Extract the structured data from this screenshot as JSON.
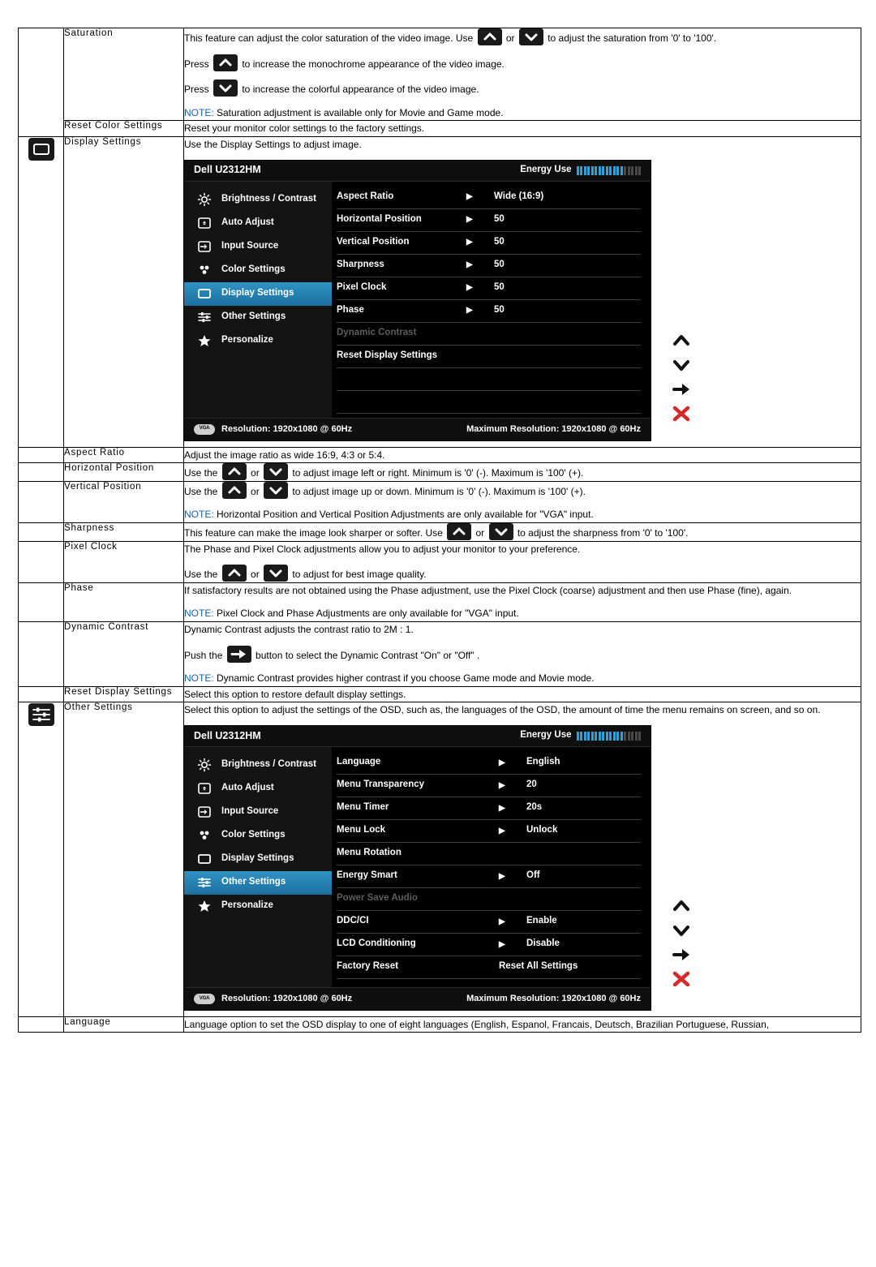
{
  "rows": [
    {
      "id": "saturation",
      "name": "Saturation",
      "lines": [
        {
          "type": "text-keys",
          "pre": "This feature can adjust the color saturation of the video image. Use ",
          "mid": " or ",
          "post": " to adjust the saturation from '0' to '100'."
        },
        {
          "type": "press-up",
          "pre": "Press ",
          "post": " to increase the monochrome appearance of the video image."
        },
        {
          "type": "press-down",
          "pre": "Press ",
          "post": " to increase the colorful appearance of the video image."
        },
        {
          "type": "note",
          "label": "NOTE:",
          "text": " Saturation adjustment is available only for Movie and Game mode."
        }
      ]
    },
    {
      "id": "reset-color-settings",
      "name": "Reset Color Settings",
      "lines": [
        {
          "type": "plain",
          "text": "Reset your monitor color settings to the factory settings."
        }
      ]
    },
    {
      "id": "display-settings",
      "name": "Display Settings",
      "lines": [
        {
          "type": "plain",
          "text": "Use the Display Settings to adjust image."
        }
      ]
    },
    {
      "id": "aspect-ratio",
      "name": "Aspect Ratio",
      "lines": [
        {
          "type": "plain",
          "text": "Adjust the image ratio as wide 16:9, 4:3 or  5:4."
        }
      ]
    },
    {
      "id": "horizontal-position",
      "name": "Horizontal Position",
      "lines": [
        {
          "type": "text-keys",
          "pre": "Use the ",
          "mid": " or ",
          "post": " to adjust image left or right. Minimum is '0' (-). Maximum is '100' (+)."
        }
      ]
    },
    {
      "id": "vertical-position",
      "name": "Vertical Position",
      "lines": [
        {
          "type": "text-keys",
          "pre": "Use the ",
          "mid": " or ",
          "post": " to adjust image up or down. Minimum is '0' (-). Maximum is '100' (+)."
        },
        {
          "type": "note",
          "label": "NOTE:",
          "text": " Horizontal Position and Vertical Position Adjustments are only available for \"VGA\" input."
        }
      ]
    },
    {
      "id": "sharpness",
      "name": "Sharpness",
      "lines": [
        {
          "type": "text-keys",
          "pre": "This feature can make the image look sharper or softer. Use ",
          "mid": " or ",
          "post": " to adjust the sharpness from '0' to '100'."
        }
      ]
    },
    {
      "id": "pixel-clock",
      "name": "Pixel Clock",
      "lines": [
        {
          "type": "plain",
          "text": "The Phase and Pixel Clock adjustments allow you to adjust your monitor to your preference."
        },
        {
          "type": "text-keys",
          "pre": "Use the ",
          "mid": " or ",
          "post": " to adjust for best image quality."
        }
      ]
    },
    {
      "id": "phase",
      "name": "Phase",
      "lines": [
        {
          "type": "plain",
          "text": "If satisfactory results are not obtained using the Phase adjustment, use the Pixel Clock (coarse) adjustment and then use Phase (fine), again."
        },
        {
          "type": "note",
          "label": "NOTE:",
          "text": " Pixel Clock and Phase Adjustments are only available for \"VGA\" input."
        }
      ]
    },
    {
      "id": "dynamic-contrast",
      "name": "Dynamic Contrast",
      "lines": [
        {
          "type": "plain",
          "text": "Dynamic Contrast adjusts the contrast ratio to 2M : 1."
        },
        {
          "type": "push-enter",
          "pre": "Push the ",
          "post": " button to select the Dynamic Contrast \"On\" or \"Off\" ."
        },
        {
          "type": "note",
          "label": "NOTE:",
          "text": " Dynamic Contrast provides higher contrast if you choose Game mode and Movie mode."
        }
      ]
    },
    {
      "id": "reset-display-settings",
      "name": "Reset Display Settings",
      "lines": [
        {
          "type": "plain",
          "text": "Select this option to restore default display settings."
        }
      ]
    },
    {
      "id": "other-settings",
      "name": "Other Settings",
      "lines": [
        {
          "type": "plain",
          "text": "Select this option to adjust the settings of the OSD, such as, the languages of the OSD, the amount of time the menu remains on screen, and so on."
        }
      ]
    },
    {
      "id": "language",
      "name": "Language",
      "lines": [
        {
          "type": "plain",
          "text": "Language option to set the OSD display to one of eight languages (English, Espanol, Francais, Deutsch, Brazilian Portuguese, Russian,"
        }
      ]
    }
  ],
  "osd_display": {
    "model": "Dell U2312HM",
    "energy_label": "Energy Use",
    "energy_bars_on": 13,
    "energy_bars_off": 5,
    "menu": [
      {
        "label": "Brightness / Contrast",
        "icon": "brightness-icon",
        "active": false
      },
      {
        "label": "Auto Adjust",
        "icon": "auto-adjust-icon",
        "active": false
      },
      {
        "label": "Input Source",
        "icon": "input-source-icon",
        "active": false
      },
      {
        "label": "Color Settings",
        "icon": "color-settings-icon",
        "active": false
      },
      {
        "label": "Display Settings",
        "icon": "display-settings-icon",
        "active": true
      },
      {
        "label": "Other Settings",
        "icon": "other-settings-icon",
        "active": false
      },
      {
        "label": "Personalize",
        "icon": "personalize-star-icon",
        "active": false
      }
    ],
    "items": [
      {
        "label": "Aspect Ratio",
        "value": "Wide (16:9)",
        "arrow": true,
        "disabled": false
      },
      {
        "label": "Horizontal Position",
        "value": "50",
        "arrow": true,
        "disabled": false
      },
      {
        "label": "Vertical Position",
        "value": "50",
        "arrow": true,
        "disabled": false
      },
      {
        "label": "Sharpness",
        "value": "50",
        "arrow": true,
        "disabled": false
      },
      {
        "label": "Pixel Clock",
        "value": "50",
        "arrow": true,
        "disabled": false
      },
      {
        "label": "Phase",
        "value": "50",
        "arrow": true,
        "disabled": false
      },
      {
        "label": "Dynamic Contrast",
        "value": "",
        "arrow": false,
        "disabled": true
      },
      {
        "label": "Reset Display Settings",
        "value": "",
        "arrow": false,
        "disabled": false
      },
      {
        "label": "",
        "value": "",
        "arrow": false,
        "disabled": false
      },
      {
        "label": "",
        "value": "",
        "arrow": false,
        "disabled": false
      }
    ],
    "footer_resolution": "Resolution: 1920x1080 @ 60Hz",
    "footer_max_resolution": "Maximum Resolution: 1920x1080 @ 60Hz",
    "vga_badge": "VGA"
  },
  "osd_other": {
    "model": "Dell U2312HM",
    "energy_label": "Energy Use",
    "energy_bars_on": 13,
    "energy_bars_off": 5,
    "menu": [
      {
        "label": "Brightness / Contrast",
        "icon": "brightness-icon",
        "active": false
      },
      {
        "label": "Auto Adjust",
        "icon": "auto-adjust-icon",
        "active": false
      },
      {
        "label": "Input Source",
        "icon": "input-source-icon",
        "active": false
      },
      {
        "label": "Color Settings",
        "icon": "color-settings-icon",
        "active": false
      },
      {
        "label": "Display Settings",
        "icon": "display-settings-icon",
        "active": false
      },
      {
        "label": "Other Settings",
        "icon": "other-settings-icon",
        "active": true
      },
      {
        "label": "Personalize",
        "icon": "personalize-star-icon",
        "active": false
      }
    ],
    "items": [
      {
        "label": "Language",
        "value": "English",
        "arrow": true,
        "disabled": false
      },
      {
        "label": "Menu Transparency",
        "value": "20",
        "arrow": true,
        "disabled": false
      },
      {
        "label": "Menu Timer",
        "value": "20s",
        "arrow": true,
        "disabled": false
      },
      {
        "label": "Menu Lock",
        "value": "Unlock",
        "arrow": true,
        "disabled": false
      },
      {
        "label": "Menu Rotation",
        "value": "",
        "arrow": false,
        "disabled": false
      },
      {
        "label": "Energy Smart",
        "value": "Off",
        "arrow": true,
        "disabled": false
      },
      {
        "label": "Power Save Audio",
        "value": "",
        "arrow": false,
        "disabled": true
      },
      {
        "label": "DDC/CI",
        "value": "Enable",
        "arrow": true,
        "disabled": false
      },
      {
        "label": "LCD Conditioning",
        "value": "Disable",
        "arrow": true,
        "disabled": false
      },
      {
        "label": "Factory Reset",
        "value": "Reset All Settings",
        "arrow": false,
        "disabled": false
      }
    ],
    "footer_resolution": "Resolution: 1920x1080 @ 60Hz",
    "footer_max_resolution": "Maximum Resolution: 1920x1080 @ 60Hz",
    "vga_badge": "VGA"
  },
  "side_buttons": [
    "up-arrow-button",
    "down-arrow-button",
    "enter-arrow-button",
    "close-x-button"
  ],
  "colors": {
    "accent": "#2f93c4",
    "note": "#1b5faa",
    "osd_bg": "#000000",
    "energy_bar": "#2ea3d8",
    "close_red": "#d42a2a"
  }
}
